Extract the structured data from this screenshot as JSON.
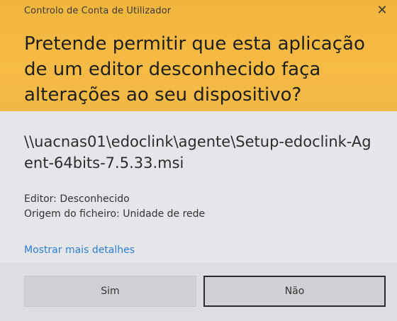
{
  "dialog": {
    "title": "Controlo de Conta de Utilizador",
    "close_glyph": "✕",
    "question": "Pretende permitir que esta aplicação de um editor desconhecido faça alterações ao seu dispositivo?",
    "filename": "\\\\uacnas01\\edoclink\\agente\\Setup-edoclink-Agent-64bits-7.5.33.msi",
    "publisher": "Editor: Desconhecido",
    "origin": "Origem do ficheiro: Unidade de rede",
    "details_link": "Mostrar mais detalhes",
    "yes_label": "Sim",
    "no_label": "Não"
  },
  "colors": {
    "header": "#f2b63d",
    "body": "#e4e6e9",
    "link": "#2e7fd0"
  }
}
